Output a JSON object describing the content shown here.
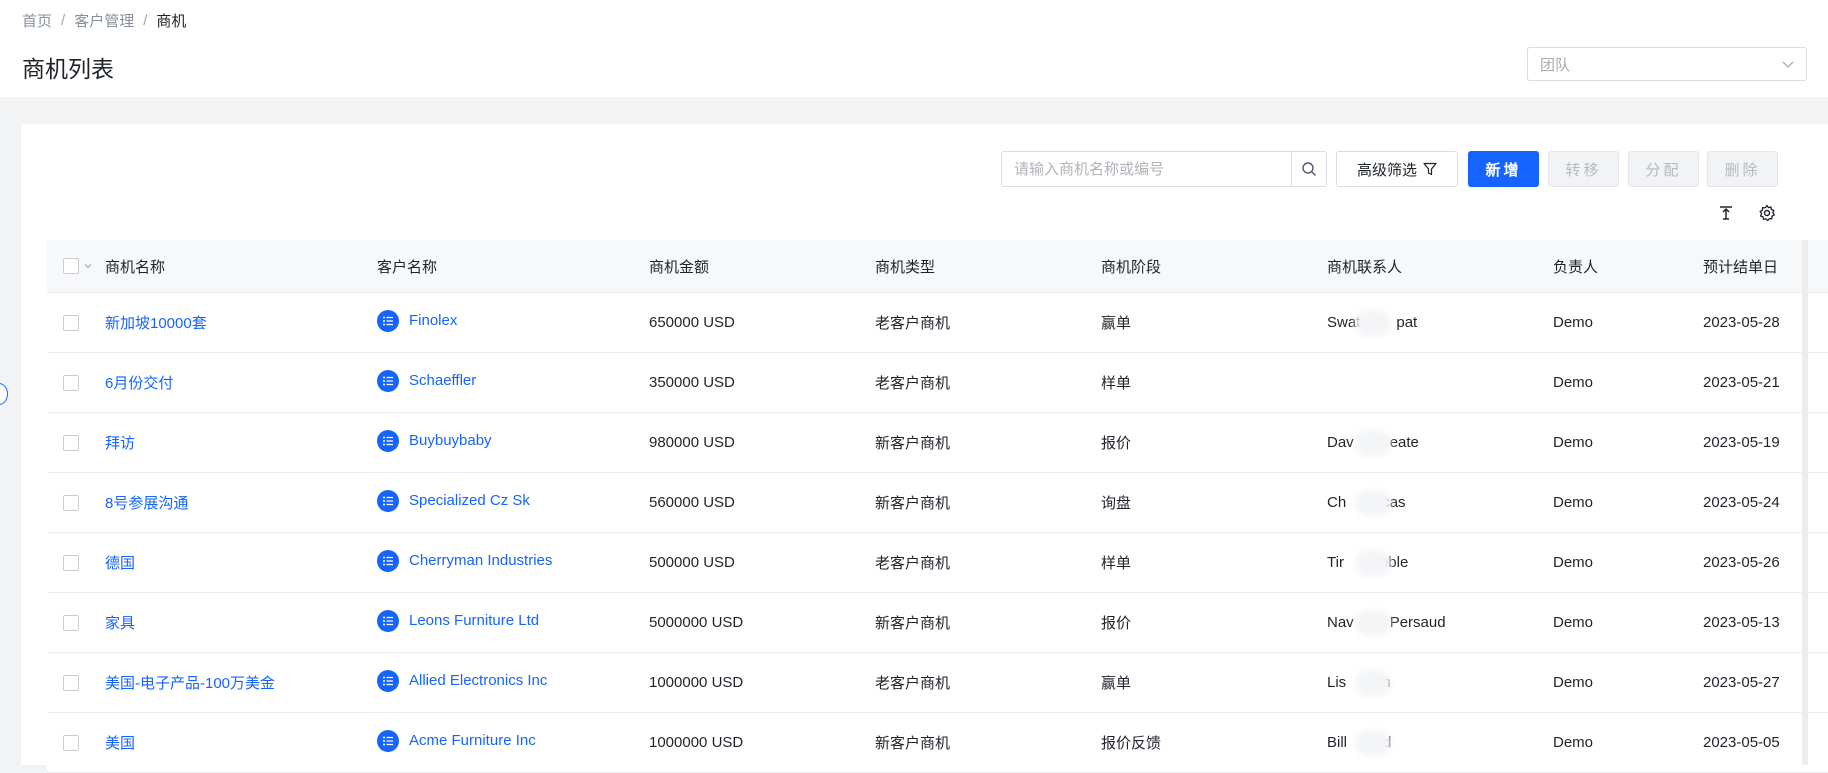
{
  "breadcrumb": {
    "items": [
      "首页",
      "客户管理",
      "商机"
    ]
  },
  "page_title": "商机列表",
  "team_select": {
    "placeholder": "团队"
  },
  "toolbar": {
    "search_placeholder": "请输入商机名称或编号",
    "advanced_filter_label": "高级筛选",
    "new_label": "新增",
    "transfer_label": "转移",
    "assign_label": "分配",
    "delete_label": "删除"
  },
  "table": {
    "headers": [
      "商机名称",
      "客户名称",
      "商机金额",
      "商机类型",
      "商机阶段",
      "商机联系人",
      "负责人",
      "预计结单日"
    ],
    "rows": [
      {
        "name": "新加坡10000套",
        "customer": "Finolex",
        "amount": "650000 USD",
        "type": "老客户商机",
        "stage": "赢单",
        "contact": "Swat",
        "contact_tail": "pat",
        "owner": "Demo",
        "date": "2023-05-28"
      },
      {
        "name": "6月份交付",
        "customer": "Schaeffler",
        "amount": "350000 USD",
        "type": "老客户商机",
        "stage": "样单",
        "contact": "",
        "contact_tail": "",
        "owner": "Demo",
        "date": "2023-05-21"
      },
      {
        "name": "拜访",
        "customer": "Buybuybaby",
        "amount": "980000 USD",
        "type": "新客户商机",
        "stage": "报价",
        "contact": "Dav",
        "contact_tail": "eate",
        "owner": "Demo",
        "date": "2023-05-19"
      },
      {
        "name": "8号参展沟通",
        "customer": "Specialized Cz Sk",
        "amount": "560000 USD",
        "type": "新客户商机",
        "stage": "询盘",
        "contact": "Ch",
        "contact_tail": "cas",
        "owner": "Demo",
        "date": "2023-05-24"
      },
      {
        "name": "德国",
        "customer": "Cherryman Industries",
        "amount": "500000 USD",
        "type": "老客户商机",
        "stage": "样单",
        "contact": "Tir",
        "contact_tail": "bble",
        "owner": "Demo",
        "date": "2023-05-26"
      },
      {
        "name": "家具",
        "customer": "Leons Furniture Ltd",
        "amount": "5000000 USD",
        "type": "新客户商机",
        "stage": "报价",
        "contact": "Nav",
        "contact_tail": "Persaud",
        "owner": "Demo",
        "date": "2023-05-13"
      },
      {
        "name": "美国-电子产品-100万美金",
        "customer": "Allied Electronics Inc",
        "amount": "1000000 USD",
        "type": "老客户商机",
        "stage": "赢单",
        "contact": "Lis",
        "contact_tail": "n",
        "owner": "Demo",
        "date": "2023-05-27"
      },
      {
        "name": "美国",
        "customer": "Acme Furniture Inc",
        "amount": "1000000 USD",
        "type": "新客户商机",
        "stage": "报价反馈",
        "contact": "Bill",
        "contact_tail": "d",
        "owner": "Demo",
        "date": "2023-05-05"
      }
    ]
  },
  "colors": {
    "primary": "#1664ff",
    "text": "#1f2329",
    "muted": "#86909c",
    "bg": "#f2f3f5"
  },
  "icons": [
    "search-icon",
    "filter-icon",
    "column-height-icon",
    "gear-icon",
    "chevron-down-icon",
    "list-icon"
  ]
}
